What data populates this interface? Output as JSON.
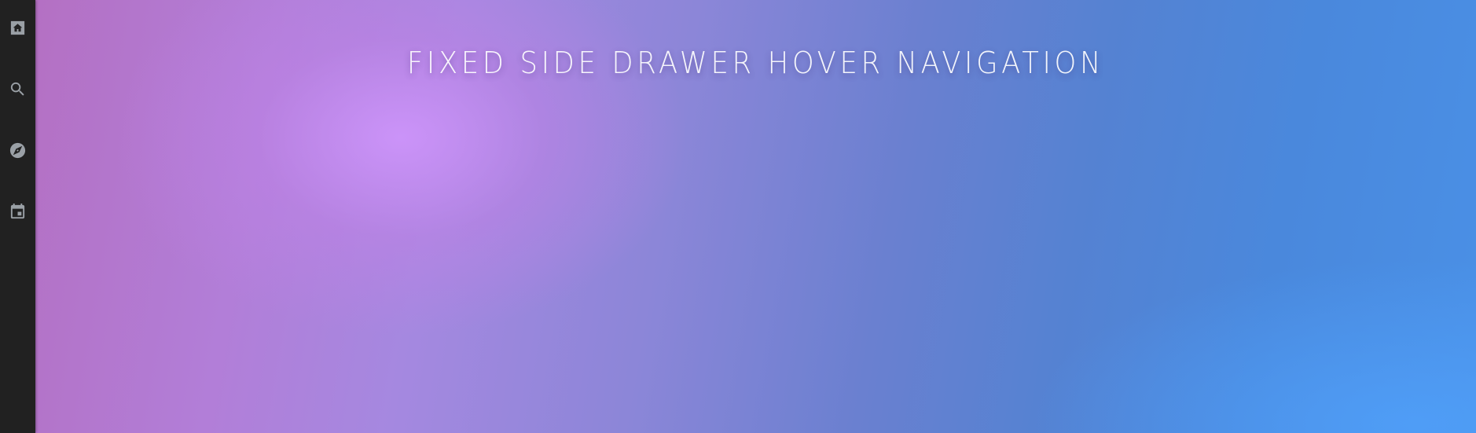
{
  "page": {
    "title": "FIXED SIDE DRAWER HOVER NAVIGATION"
  },
  "sidebar": {
    "background": "#212121",
    "icon_color": "#9aa0a6",
    "items": [
      {
        "icon": "home-icon"
      },
      {
        "icon": "search-icon"
      },
      {
        "icon": "explore-icon"
      },
      {
        "icon": "calendar-icon"
      }
    ]
  },
  "theme": {
    "gradient_start": "#b46ec0",
    "gradient_highlight": "#cd94fa",
    "gradient_end": "#4a90e6"
  }
}
